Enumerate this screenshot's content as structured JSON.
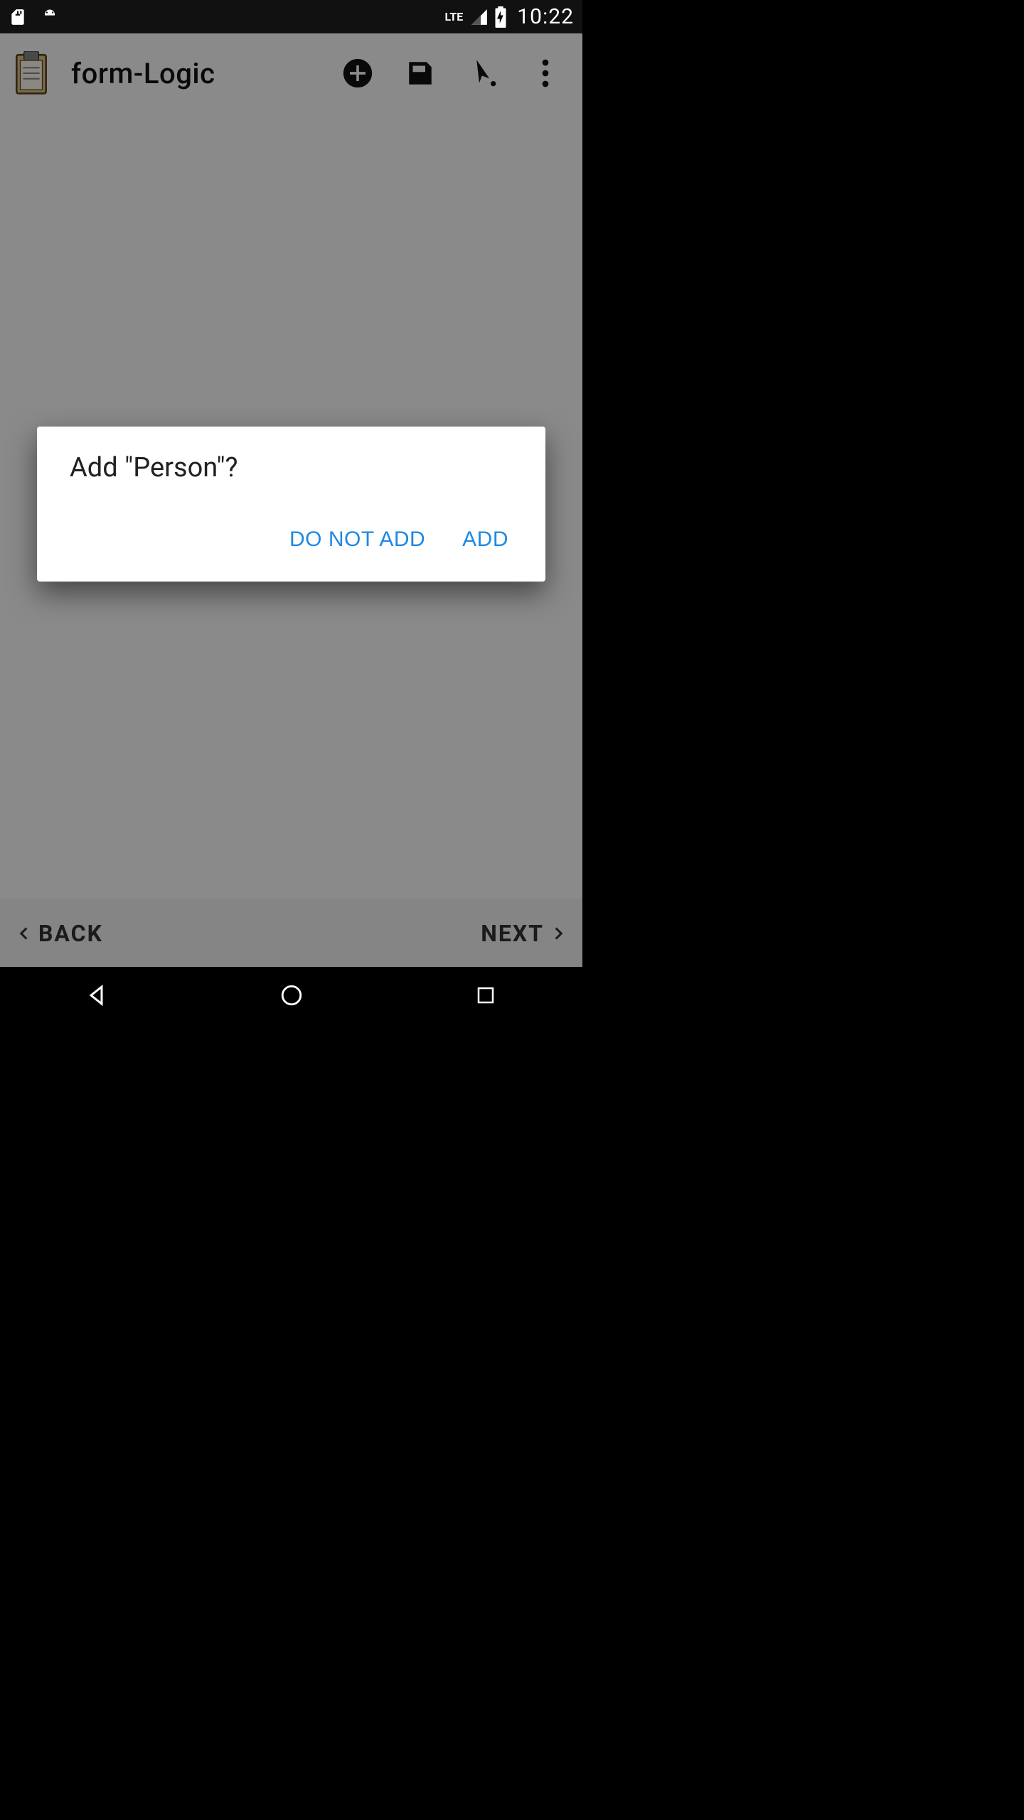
{
  "status": {
    "clock": "10:22",
    "network_label": "LTE"
  },
  "appbar": {
    "title": "form-Logic"
  },
  "bottombar": {
    "back_label": "BACK",
    "next_label": "NEXT"
  },
  "dialog": {
    "title": "Add \"Person\"?",
    "negative_label": "DO NOT ADD",
    "positive_label": "ADD"
  },
  "colors": {
    "accent": "#1E88E5"
  }
}
